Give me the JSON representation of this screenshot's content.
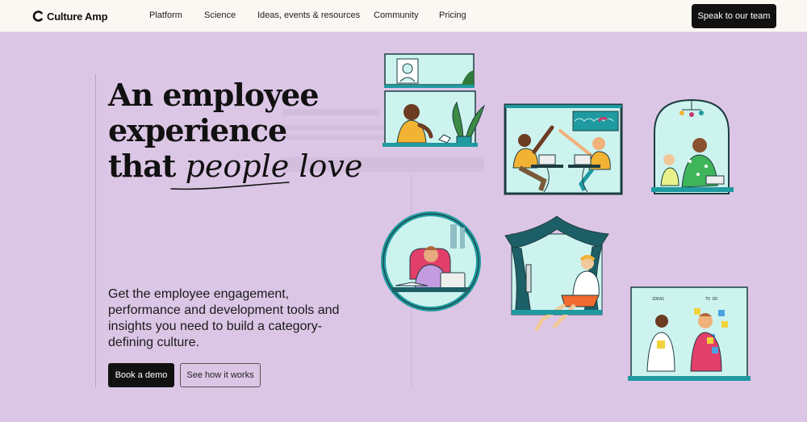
{
  "brand": {
    "name": "Culture Amp"
  },
  "nav": {
    "links": [
      "Platform",
      "Science",
      "Ideas, events & resources",
      "Community",
      "Pricing"
    ],
    "cta": "Speak to our team"
  },
  "hero": {
    "headline_line1": "An employee",
    "headline_line2": "experience",
    "headline_line3_prefix": "that",
    "headline_line3_script": "people love",
    "subheadline": "Get the employee engagement, performance and development tools and insights you need to build a category-defining culture.",
    "primary_button": "Book a demo",
    "secondary_button": "See how it works"
  },
  "illustrations": {
    "sticky_note_left": "IDEAS",
    "sticky_note_right": "TO DO"
  },
  "colors": {
    "background": "#dcc6e6",
    "nav_background": "#fbf7f2",
    "teal": "#1f9aa0",
    "dark_teal": "#1d5f66",
    "mint": "#cdf3ef"
  }
}
